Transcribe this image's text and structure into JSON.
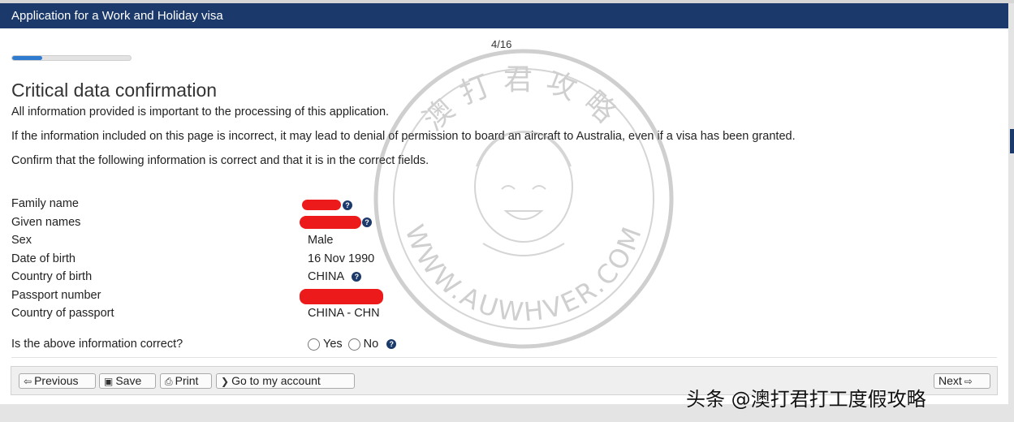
{
  "window": {
    "title": "Application for a Work and Holiday visa"
  },
  "progress": {
    "step_text": "4/16",
    "fraction": 0.25
  },
  "page": {
    "heading": "Critical data confirmation",
    "paragraphs": [
      "All information provided is important to the processing of this application.",
      "If the information included on this page is incorrect, it may lead to denial of permission to board an aircraft to Australia, even if a visa has been granted.",
      "Confirm that the following information is correct and that it is in the correct fields."
    ]
  },
  "fields": {
    "family_name": {
      "label": "Family name",
      "value": ""
    },
    "given_names": {
      "label": "Given names",
      "value": ""
    },
    "sex": {
      "label": "Sex",
      "value": "Male"
    },
    "dob": {
      "label": "Date of birth",
      "value": "16 Nov 1990"
    },
    "country_of_birth": {
      "label": "Country of birth",
      "value": "CHINA"
    },
    "passport_number": {
      "label": "Passport number",
      "value": ""
    },
    "country_of_passport": {
      "label": "Country of passport",
      "value": "CHINA - CHN"
    }
  },
  "confirm": {
    "question": "Is the above information correct?",
    "yes": "Yes",
    "no": "No",
    "selected": null
  },
  "toolbar": {
    "previous": "Previous",
    "save": "Save",
    "print": "Print",
    "account": "Go to my account",
    "next": "Next"
  },
  "watermark": {
    "caption": "头条 @澳打君打工度假攻略",
    "stamp_top": "澳打君攻略",
    "stamp_bottom": "WWW.AUWHVER.COM"
  },
  "colors": {
    "titlebar": "#1b3a6b",
    "progress_fill": "#2f7bd0",
    "redaction": "#ec1a1a"
  }
}
